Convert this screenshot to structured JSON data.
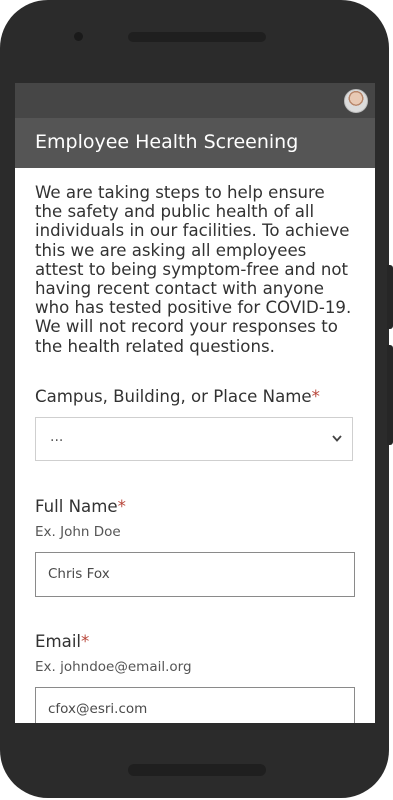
{
  "form": {
    "title": "Employee Health Screening",
    "intro": "We are taking steps to help ensure the safety and public health of all individuals in our facilities. To achieve this we are asking all employees attest to being symptom-free and not having recent contact with anyone who has tested positive for COVID-19. We will not record your responses to the health related questions.",
    "required_marker": "*"
  },
  "fields": {
    "place": {
      "label": "Campus, Building, or Place Name",
      "value": "...",
      "icon": "chevron-down-icon"
    },
    "full_name": {
      "label": "Full Name",
      "hint": "Ex. John Doe",
      "value": "Chris Fox"
    },
    "email": {
      "label": "Email",
      "hint": "Ex. johndoe@email.org",
      "value": "cfox@esri.com"
    }
  },
  "colors": {
    "header": "#555555",
    "status_bar": "#464646",
    "required": "#b8463a",
    "device": "#2b2b2b"
  }
}
